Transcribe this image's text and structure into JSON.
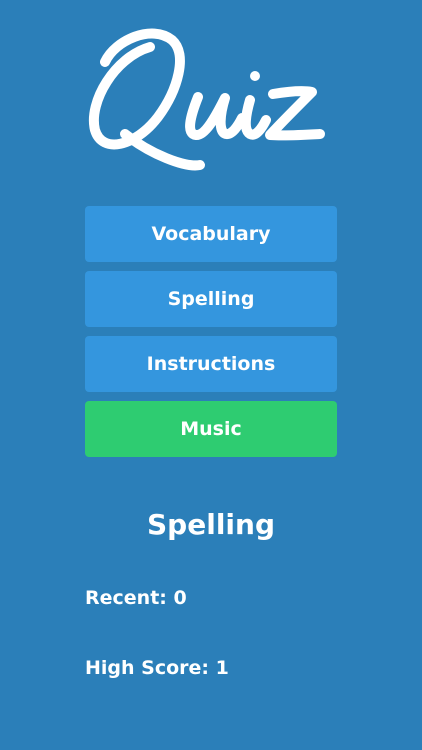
{
  "logo": {
    "text": "Quiz",
    "color": "#ffffff"
  },
  "menu": {
    "items": [
      {
        "label": "Vocabulary"
      },
      {
        "label": "Spelling"
      },
      {
        "label": "Instructions"
      },
      {
        "label": "Music"
      }
    ]
  },
  "section": {
    "title": "Spelling"
  },
  "stats": {
    "recent": "Recent: 0",
    "high_score": "High Score: 1"
  },
  "colors": {
    "background": "#2b7fb9",
    "button_blue": "#3496de",
    "button_green": "#2ecc71",
    "text": "#ffffff"
  }
}
